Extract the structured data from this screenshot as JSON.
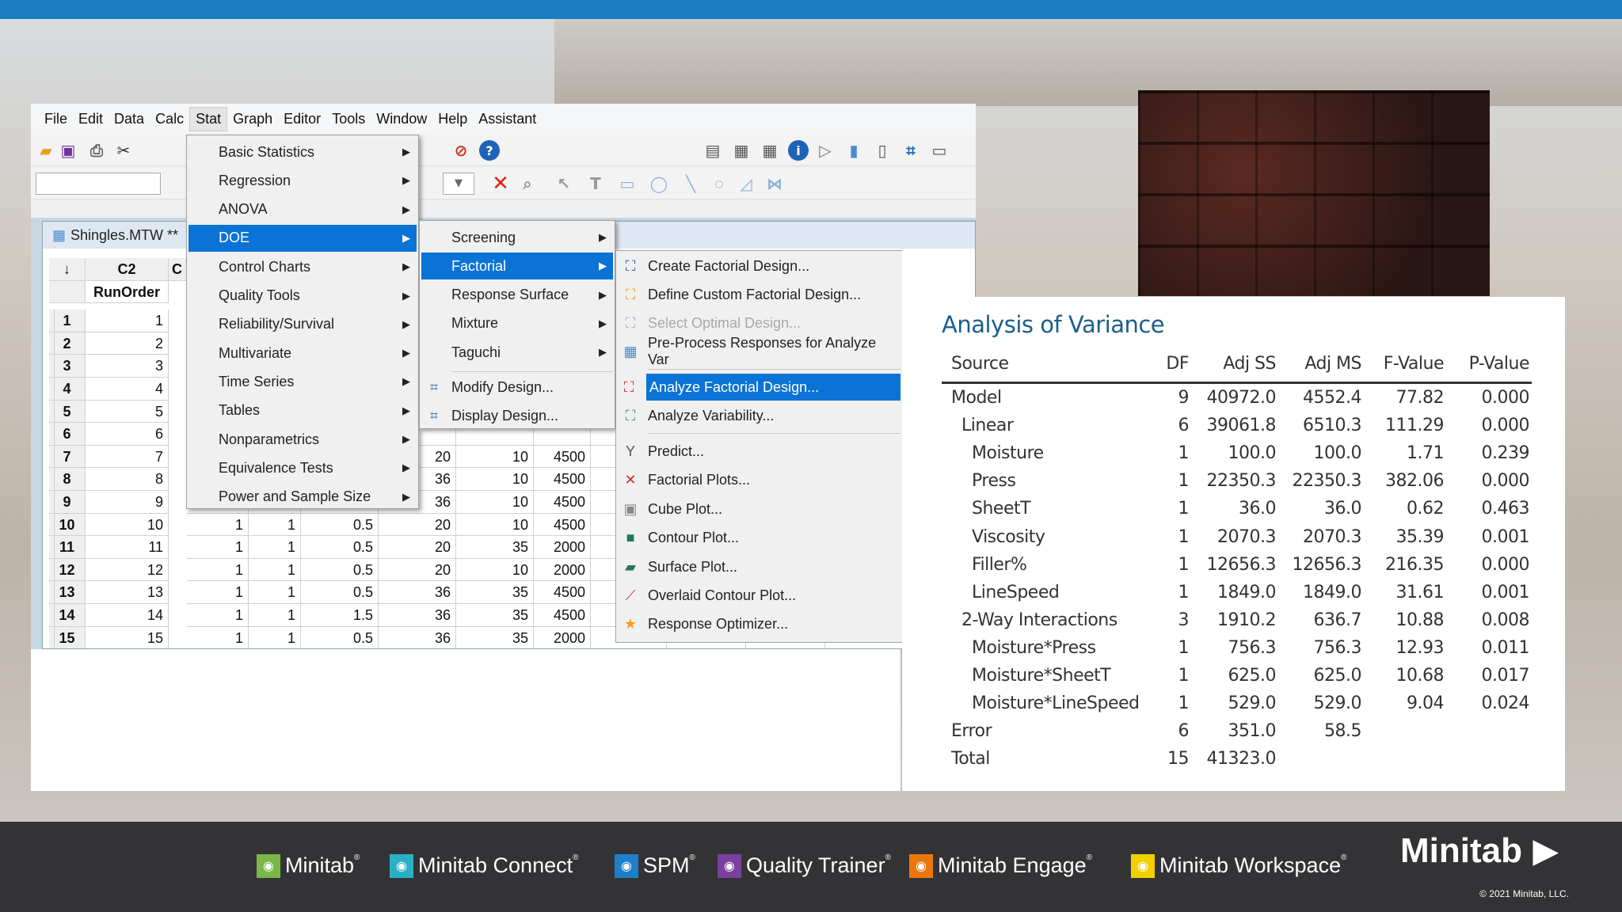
{
  "menubar": [
    "File",
    "Edit",
    "Data",
    "Calc",
    "Stat",
    "Graph",
    "Editor",
    "Tools",
    "Window",
    "Help",
    "Assistant"
  ],
  "sheet": {
    "title": "Shingles.MTW **",
    "col_id": "C2",
    "col_name": "RunOrder",
    "col_next": "C",
    "rows": [
      {
        "n": "1",
        "c2": "1",
        "v": []
      },
      {
        "n": "2",
        "c2": "2",
        "v": []
      },
      {
        "n": "3",
        "c2": "3",
        "v": []
      },
      {
        "n": "4",
        "c2": "4",
        "v": []
      },
      {
        "n": "5",
        "c2": "5",
        "v": []
      },
      {
        "n": "6",
        "c2": "6",
        "v": []
      },
      {
        "n": "7",
        "c2": "7",
        "v": [
          "",
          "",
          "",
          "20",
          "10",
          "4500"
        ]
      },
      {
        "n": "8",
        "c2": "8",
        "v": [
          "",
          "",
          "",
          "36",
          "10",
          "4500"
        ]
      },
      {
        "n": "9",
        "c2": "9",
        "v": [
          "",
          "",
          "",
          "36",
          "10",
          "4500"
        ]
      },
      {
        "n": "10",
        "c2": "10",
        "v": [
          "1",
          "1",
          "0.5",
          "20",
          "10",
          "4500"
        ]
      },
      {
        "n": "11",
        "c2": "11",
        "v": [
          "1",
          "1",
          "0.5",
          "20",
          "35",
          "2000"
        ]
      },
      {
        "n": "12",
        "c2": "12",
        "v": [
          "1",
          "1",
          "0.5",
          "20",
          "10",
          "2000"
        ]
      },
      {
        "n": "13",
        "c2": "13",
        "v": [
          "1",
          "1",
          "0.5",
          "36",
          "35",
          "4500"
        ]
      },
      {
        "n": "14",
        "c2": "14",
        "v": [
          "1",
          "1",
          "1.5",
          "36",
          "35",
          "4500"
        ]
      },
      {
        "n": "15",
        "c2": "15",
        "v": [
          "1",
          "1",
          "0.5",
          "36",
          "35",
          "2000"
        ]
      }
    ]
  },
  "stat_menu": [
    "Basic Statistics",
    "Regression",
    "ANOVA",
    "DOE",
    "Control Charts",
    "Quality Tools",
    "Reliability/Survival",
    "Multivariate",
    "Time Series",
    "Tables",
    "Nonparametrics",
    "Equivalence Tests",
    "Power and Sample Size"
  ],
  "doe_menu": {
    "sub": [
      "Screening",
      "Factorial",
      "Response Surface",
      "Mixture",
      "Taguchi"
    ],
    "actions": [
      "Modify Design...",
      "Display Design..."
    ]
  },
  "factorial_menu": [
    {
      "label": "Create Factorial Design...",
      "icon": "create-design-icon"
    },
    {
      "label": "Define Custom Factorial Design...",
      "icon": "define-custom-icon"
    },
    {
      "label": "Select Optimal Design...",
      "icon": "optimal-design-icon",
      "disabled": true
    },
    {
      "label": "Pre-Process Responses for Analyze Var",
      "icon": "preprocess-icon"
    },
    {
      "label": "Analyze Factorial Design...",
      "icon": "analyze-design-icon",
      "selected": true
    },
    {
      "label": "Analyze Variability...",
      "icon": "analyze-variability-icon"
    },
    {
      "label": "Predict...",
      "icon": "predict-icon"
    },
    {
      "label": "Factorial Plots...",
      "icon": "factorial-plots-icon"
    },
    {
      "label": "Cube Plot...",
      "icon": "cube-plot-icon"
    },
    {
      "label": "Contour Plot...",
      "icon": "contour-plot-icon"
    },
    {
      "label": "Surface Plot...",
      "icon": "surface-plot-icon"
    },
    {
      "label": "Overlaid Contour Plot...",
      "icon": "overlaid-contour-icon"
    },
    {
      "label": "Response Optimizer...",
      "icon": "response-optimizer-icon"
    }
  ],
  "anova": {
    "title": "Analysis of Variance",
    "headers": [
      "Source",
      "DF",
      "Adj SS",
      "Adj MS",
      "F-Value",
      "P-Value"
    ],
    "rows": [
      {
        "s": "Model",
        "lvl": 0,
        "v": [
          "9",
          "40972.0",
          "4552.4",
          "77.82",
          "0.000"
        ]
      },
      {
        "s": "Linear",
        "lvl": 1,
        "v": [
          "6",
          "39061.8",
          "6510.3",
          "111.29",
          "0.000"
        ]
      },
      {
        "s": "Moisture",
        "lvl": 2,
        "v": [
          "1",
          "100.0",
          "100.0",
          "1.71",
          "0.239"
        ]
      },
      {
        "s": "Press",
        "lvl": 2,
        "v": [
          "1",
          "22350.3",
          "22350.3",
          "382.06",
          "0.000"
        ]
      },
      {
        "s": "SheetT",
        "lvl": 2,
        "v": [
          "1",
          "36.0",
          "36.0",
          "0.62",
          "0.463"
        ]
      },
      {
        "s": "Viscosity",
        "lvl": 2,
        "v": [
          "1",
          "2070.3",
          "2070.3",
          "35.39",
          "0.001"
        ]
      },
      {
        "s": "Filler%",
        "lvl": 2,
        "v": [
          "1",
          "12656.3",
          "12656.3",
          "216.35",
          "0.000"
        ]
      },
      {
        "s": "LineSpeed",
        "lvl": 2,
        "v": [
          "1",
          "1849.0",
          "1849.0",
          "31.61",
          "0.001"
        ]
      },
      {
        "s": "2-Way Interactions",
        "lvl": 1,
        "v": [
          "3",
          "1910.2",
          "636.7",
          "10.88",
          "0.008"
        ]
      },
      {
        "s": "Moisture*Press",
        "lvl": 2,
        "v": [
          "1",
          "756.3",
          "756.3",
          "12.93",
          "0.011"
        ]
      },
      {
        "s": "Moisture*SheetT",
        "lvl": 2,
        "v": [
          "1",
          "625.0",
          "625.0",
          "10.68",
          "0.017"
        ]
      },
      {
        "s": "Moisture*LineSpeed",
        "lvl": 2,
        "v": [
          "1",
          "529.0",
          "529.0",
          "9.04",
          "0.024"
        ]
      },
      {
        "s": "Error",
        "lvl": 0,
        "v": [
          "6",
          "351.0",
          "58.5",
          "",
          ""
        ]
      },
      {
        "s": "Total",
        "lvl": 0,
        "v": [
          "15",
          "41323.0",
          "",
          "",
          ""
        ]
      }
    ]
  },
  "footer": {
    "products": [
      {
        "name": "Minitab",
        "color": "#7ab648"
      },
      {
        "name": "Minitab Connect",
        "color": "#2ab0c5"
      },
      {
        "name": "SPM",
        "color": "#1e7fc8"
      },
      {
        "name": "Quality Trainer",
        "color": "#7b3fa0"
      },
      {
        "name": "Minitab Engage",
        "color": "#e8780c"
      },
      {
        "name": "Minitab Workspace",
        "color": "#f2d000"
      }
    ],
    "brand": "Minitab",
    "copyright": "© 2021 Minitab, LLC."
  }
}
